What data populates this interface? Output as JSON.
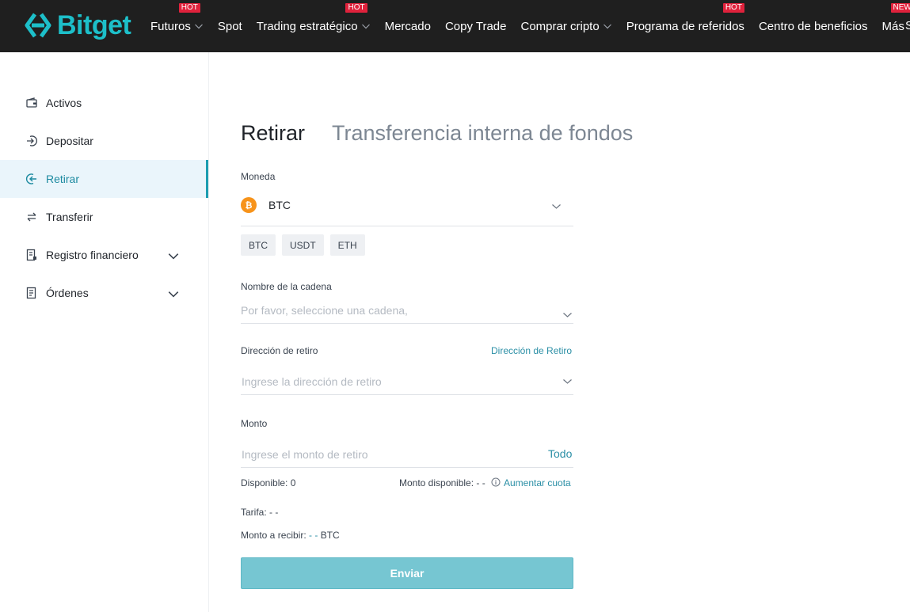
{
  "brand": {
    "name": "Bitget",
    "accent": "#1dbfc9"
  },
  "nav": {
    "items": [
      {
        "label": "Futuros",
        "badge": "HOT",
        "dropdown": true
      },
      {
        "label": "Spot",
        "badge": "",
        "dropdown": false
      },
      {
        "label": "Trading estratégico",
        "badge": "HOT",
        "dropdown": true
      },
      {
        "label": "Mercado",
        "badge": "",
        "dropdown": false
      },
      {
        "label": "Copy Trade",
        "badge": "",
        "dropdown": false
      },
      {
        "label": "Comprar cripto",
        "badge": "",
        "dropdown": true
      },
      {
        "label": "Programa de referidos",
        "badge": "HOT",
        "dropdown": false
      },
      {
        "label": "Centro de beneficios",
        "badge": "",
        "dropdown": false
      },
      {
        "label": "Más",
        "badge": "NEW",
        "dropdown": true
      }
    ],
    "cut_label": "S"
  },
  "sidebar": {
    "items": [
      {
        "label": "Activos",
        "icon": "wallet-icon"
      },
      {
        "label": "Depositar",
        "icon": "deposit-icon"
      },
      {
        "label": "Retirar",
        "icon": "withdraw-icon",
        "active": true
      },
      {
        "label": "Transferir",
        "icon": "transfer-icon"
      },
      {
        "label": "Registro financiero",
        "icon": "record-icon",
        "expandable": true
      },
      {
        "label": "Órdenes",
        "icon": "orders-icon",
        "expandable": true
      }
    ]
  },
  "main": {
    "tabs": {
      "active": "Retirar",
      "inactive": "Transferencia interna de fondos"
    },
    "coin": {
      "label": "Moneda",
      "value": "BTC",
      "quick": [
        "BTC",
        "USDT",
        "ETH"
      ]
    },
    "chain": {
      "label": "Nombre de la cadena",
      "placeholder": "Por favor, seleccione una cadena,"
    },
    "address": {
      "label": "Dirección de retiro",
      "link": "Dirección de Retiro",
      "placeholder": "Ingrese la dirección de retiro"
    },
    "amount": {
      "label": "Monto",
      "placeholder": "Ingrese el monto de retiro",
      "all": "Todo"
    },
    "available": {
      "label": "Disponible:",
      "value": "0",
      "quota_label": "Monto disponible:",
      "quota_value": "- -",
      "increase": "Aumentar cuota"
    },
    "fee": {
      "label": "Tarifa:",
      "value": "- -"
    },
    "receive": {
      "label": "Monto a recibir:",
      "value": "- -",
      "unit": "BTC"
    },
    "submit": "Enviar"
  }
}
